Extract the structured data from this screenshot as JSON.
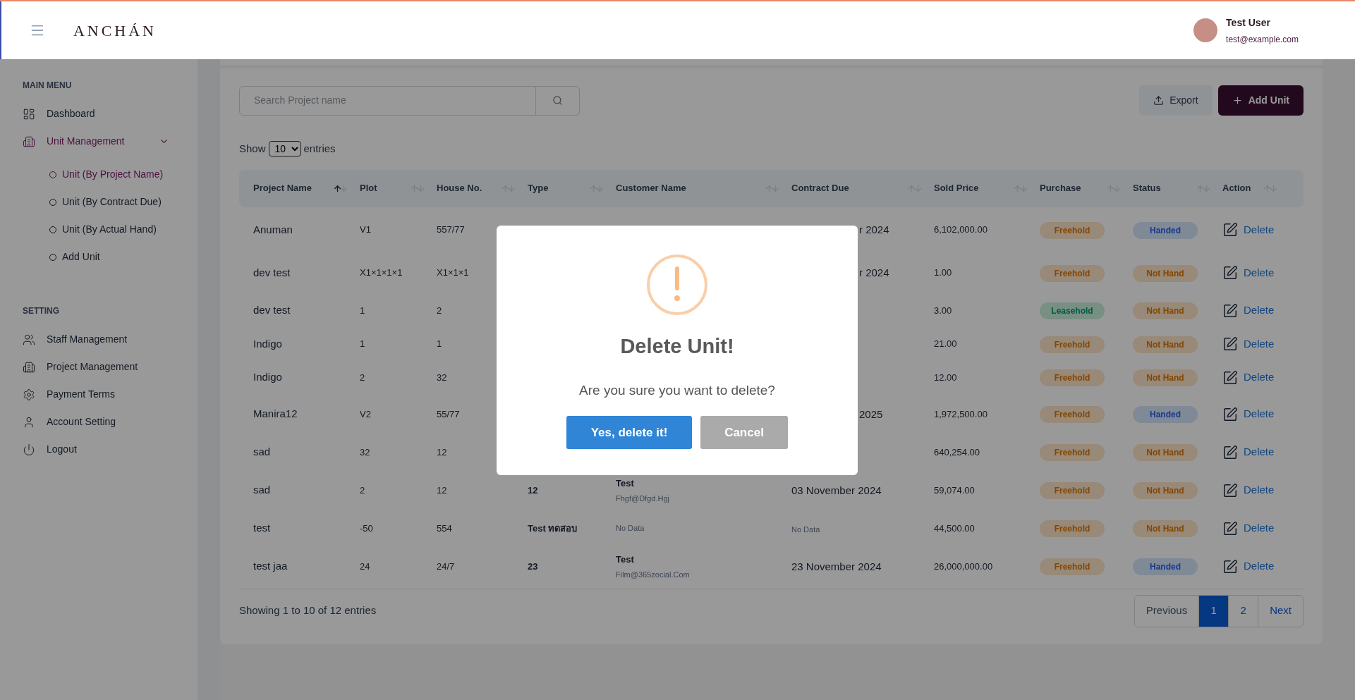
{
  "header": {
    "logo": "ANCHÁN",
    "user": {
      "name": "Test User",
      "email": "test@example.com"
    }
  },
  "sidebar": {
    "sections": [
      {
        "title": "MAIN MENU",
        "items": [
          {
            "label": "Dashboard",
            "selected": false
          },
          {
            "label": "Unit Management",
            "selected": true,
            "expanded": true,
            "children": [
              {
                "label": "Unit (By Project Name)",
                "selected": true
              },
              {
                "label": "Unit (By Contract Due)",
                "selected": false
              },
              {
                "label": "Unit (By Actual Hand)",
                "selected": false
              },
              {
                "label": "Add Unit",
                "selected": false
              }
            ]
          }
        ]
      },
      {
        "title": "SETTING",
        "items": [
          {
            "label": "Staff Management",
            "selected": false
          },
          {
            "label": "Project Management",
            "selected": false
          },
          {
            "label": "Payment Terms",
            "selected": false
          },
          {
            "label": "Account Setting",
            "selected": false
          },
          {
            "label": "Logout",
            "selected": false
          }
        ]
      }
    ]
  },
  "toolbar": {
    "search": {
      "placeholder": "Search Project name"
    },
    "buttons": [
      {
        "label": "Export",
        "kind": "export"
      },
      {
        "label": "Add Unit",
        "kind": "add"
      }
    ]
  },
  "entries": {
    "before": "Show",
    "value": "10",
    "after": "entries"
  },
  "table": {
    "columns": [
      {
        "label": "Project Name",
        "sorted": true
      },
      {
        "label": "Plot",
        "sorted": false
      },
      {
        "label": "House No.",
        "sorted": false
      },
      {
        "label": "Type",
        "sorted": false
      },
      {
        "label": "Customer Name",
        "sorted": false
      },
      {
        "label": "Contract Due",
        "sorted": false
      },
      {
        "label": "Sold Price",
        "sorted": false
      },
      {
        "label": "Purchase",
        "sorted": false
      },
      {
        "label": "Status",
        "sorted": false
      },
      {
        "label": "Action",
        "sorted": false
      }
    ],
    "rows": [
      {
        "project": "Anuman",
        "plot": "V1",
        "house": "557/77",
        "due": "r 2024",
        "price": "6,102,000.00",
        "purchase": {
          "label": "Freehold",
          "kind": "warning"
        },
        "status": {
          "label": "Handed",
          "kind": "info"
        },
        "action": "Delete"
      },
      {
        "project": "dev test",
        "plot": "X1×1×1×1",
        "house": "X1×1×1",
        "due": "r 2024",
        "price": "1.00",
        "purchase": {
          "label": "Freehold",
          "kind": "warning"
        },
        "status": {
          "label": "Not Hand",
          "kind": "warning"
        },
        "action": "Delete"
      },
      {
        "project": "dev test",
        "plot": "1",
        "house": "2",
        "price": "3.00",
        "purchase": {
          "label": "Leasehold",
          "kind": "success"
        },
        "status": {
          "label": "Not Hand",
          "kind": "warning"
        },
        "action": "Delete"
      },
      {
        "project": "Indigo",
        "plot": "1",
        "house": "1",
        "price": "21.00",
        "purchase": {
          "label": "Freehold",
          "kind": "warning"
        },
        "status": {
          "label": "Not Hand",
          "kind": "warning"
        },
        "action": "Delete"
      },
      {
        "project": "Indigo",
        "plot": "2",
        "house": "32",
        "price": "12.00",
        "purchase": {
          "label": "Freehold",
          "kind": "warning"
        },
        "status": {
          "label": "Not Hand",
          "kind": "warning"
        },
        "action": "Delete"
      },
      {
        "project": "Manira12",
        "plot": "V2",
        "house": "55/77",
        "due": "2025",
        "price": "1,972,500.00",
        "purchase": {
          "label": "Freehold",
          "kind": "warning"
        },
        "status": {
          "label": "Handed",
          "kind": "info"
        },
        "action": "Delete"
      },
      {
        "project": "sad",
        "plot": "32",
        "house": "12",
        "price": "640,254.00",
        "purchase": {
          "label": "Freehold",
          "kind": "warning"
        },
        "status": {
          "label": "Not Hand",
          "kind": "warning"
        },
        "action": "Delete"
      },
      {
        "project": "sad",
        "plot": "2",
        "house": "12",
        "type": "12",
        "customer": {
          "name": "Test",
          "email": "Fhgf@Dfgd.Hgj"
        },
        "due": "03 November 2024",
        "price": "59,074.00",
        "purchase": {
          "label": "Freehold",
          "kind": "warning"
        },
        "status": {
          "label": "Not Hand",
          "kind": "warning"
        },
        "action": "Delete"
      },
      {
        "project": "test",
        "plot": "-50",
        "house": "554",
        "type": "Test ทดสอบ",
        "customer": {
          "empty": "No Data"
        },
        "due_empty": "No Data",
        "price": "44,500.00",
        "purchase": {
          "label": "Freehold",
          "kind": "warning"
        },
        "status": {
          "label": "Not Hand",
          "kind": "warning"
        },
        "action": "Delete"
      },
      {
        "project": "test jaa",
        "plot": "24",
        "house": "24/7",
        "type": "23",
        "customer": {
          "name": "Test",
          "email": "Film@365zocial.Com"
        },
        "due": "23 November 2024",
        "price": "26,000,000.00",
        "purchase": {
          "label": "Freehold",
          "kind": "warning"
        },
        "status": {
          "label": "Handed",
          "kind": "info"
        },
        "action": "Delete"
      }
    ]
  },
  "footer": {
    "info": "Showing 1 to 10 of 12 entries",
    "pages": [
      {
        "label": "Previous",
        "kind": "prev",
        "selected": false
      },
      {
        "label": "1",
        "kind": "page",
        "selected": true
      },
      {
        "label": "2",
        "kind": "page",
        "selected": false
      },
      {
        "label": "Next",
        "kind": "next",
        "selected": false
      }
    ]
  },
  "dialog": {
    "title": "Delete Unit!",
    "message": "Are you sure you want to delete?",
    "buttons": [
      {
        "label": "Yes, delete it!",
        "kind": "confirm"
      },
      {
        "label": "Cancel",
        "kind": "cancel"
      }
    ]
  }
}
